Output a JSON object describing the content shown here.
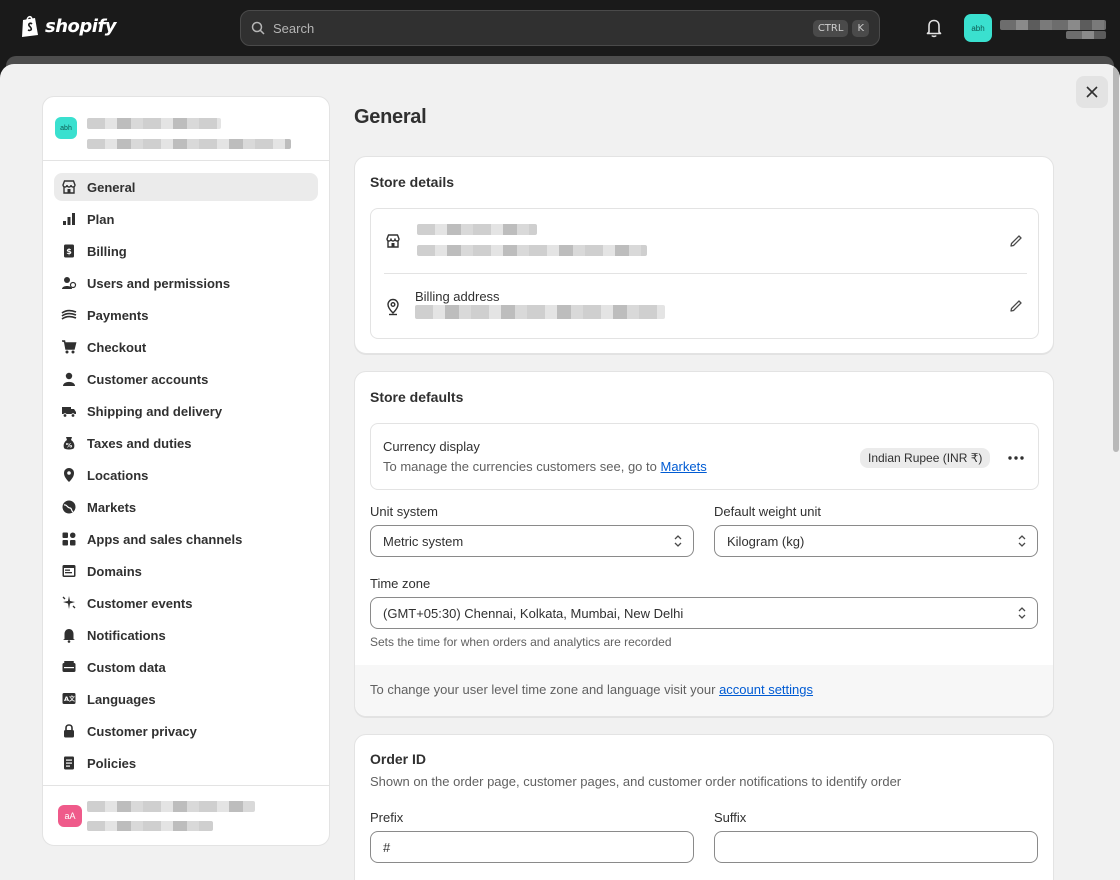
{
  "topbar": {
    "logo_text": "shopify",
    "search_placeholder": "Search",
    "shortcut_ctrl": "CTRL",
    "shortcut_k": "K",
    "avatar_initials": "abh"
  },
  "sidebar": {
    "store_avatar": "abh",
    "items": [
      {
        "label": "General",
        "icon": "store-icon"
      },
      {
        "label": "Plan",
        "icon": "plan-chart-icon"
      },
      {
        "label": "Billing",
        "icon": "billing-receipt-icon"
      },
      {
        "label": "Users and permissions",
        "icon": "users-icon"
      },
      {
        "label": "Payments",
        "icon": "payments-icon"
      },
      {
        "label": "Checkout",
        "icon": "cart-icon"
      },
      {
        "label": "Customer accounts",
        "icon": "person-icon"
      },
      {
        "label": "Shipping and delivery",
        "icon": "truck-icon"
      },
      {
        "label": "Taxes and duties",
        "icon": "tax-icon"
      },
      {
        "label": "Locations",
        "icon": "location-pin-icon"
      },
      {
        "label": "Markets",
        "icon": "globe-icon"
      },
      {
        "label": "Apps and sales channels",
        "icon": "apps-icon"
      },
      {
        "label": "Domains",
        "icon": "domains-icon"
      },
      {
        "label": "Customer events",
        "icon": "sparkle-icon"
      },
      {
        "label": "Notifications",
        "icon": "bell-icon"
      },
      {
        "label": "Custom data",
        "icon": "custom-data-icon"
      },
      {
        "label": "Languages",
        "icon": "language-icon"
      },
      {
        "label": "Customer privacy",
        "icon": "lock-icon"
      },
      {
        "label": "Policies",
        "icon": "policies-icon"
      }
    ],
    "footer_avatar": "aA"
  },
  "main": {
    "page_title": "General",
    "store_details": {
      "title": "Store details",
      "billing_address_label": "Billing address"
    },
    "store_defaults": {
      "title": "Store defaults",
      "currency_title": "Currency display",
      "currency_help": "To manage the currencies customers see, go to",
      "currency_link": "Markets",
      "currency_badge": "Indian Rupee (INR ₹)",
      "unit_system_label": "Unit system",
      "unit_system_value": "Metric system",
      "weight_unit_label": "Default weight unit",
      "weight_unit_value": "Kilogram (kg)",
      "timezone_label": "Time zone",
      "timezone_value": "(GMT+05:30) Chennai, Kolkata, Mumbai, New Delhi",
      "timezone_help": "Sets the time for when orders and analytics are recorded",
      "account_note": "To change your user level time zone and language visit your",
      "account_link": "account settings"
    },
    "order_id": {
      "title": "Order ID",
      "description": "Shown on the order page, customer pages, and customer order notifications to identify order",
      "prefix_label": "Prefix",
      "prefix_value": "#",
      "suffix_label": "Suffix",
      "suffix_value": ""
    }
  }
}
